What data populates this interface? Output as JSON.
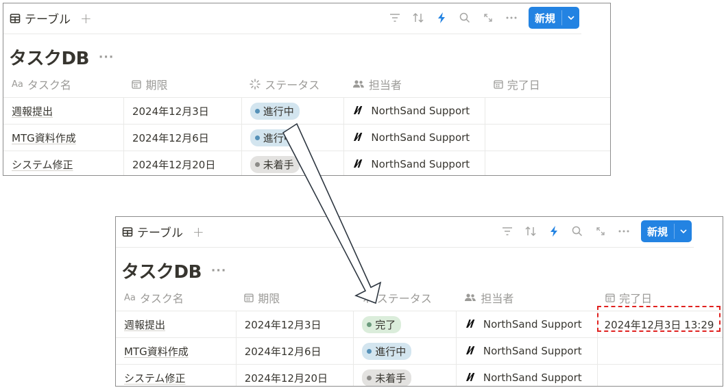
{
  "before": {
    "view_tab": "テーブル",
    "new_button": "新規",
    "db_title": "タスクDB",
    "columns": [
      "タスク名",
      "期限",
      "ステータス",
      "担当者",
      "完了日"
    ],
    "rows": [
      {
        "name": "週報提出",
        "deadline": "2024年12月3日",
        "status": "進行中",
        "status_color": "blue",
        "assignee": "NorthSand Support",
        "done_date": ""
      },
      {
        "name": "MTG資料作成",
        "deadline": "2024年12月6日",
        "status": "進行中",
        "status_color": "blue",
        "assignee": "NorthSand Support",
        "done_date": ""
      },
      {
        "name": "システム修正",
        "deadline": "2024年12月20日",
        "status": "未着手",
        "status_color": "gray",
        "assignee": "NorthSand Support",
        "done_date": ""
      }
    ]
  },
  "after": {
    "view_tab": "テーブル",
    "new_button": "新規",
    "db_title": "タスクDB",
    "columns": [
      "タスク名",
      "期限",
      "ステータス",
      "担当者",
      "完了日"
    ],
    "rows": [
      {
        "name": "週報提出",
        "deadline": "2024年12月3日",
        "status": "完了",
        "status_color": "green",
        "assignee": "NorthSand Support",
        "done_date": "2024年12月3日 13:29"
      },
      {
        "name": "MTG資料作成",
        "deadline": "2024年12月6日",
        "status": "進行中",
        "status_color": "blue",
        "assignee": "NorthSand Support",
        "done_date": ""
      },
      {
        "name": "システム修正",
        "deadline": "2024年12月20日",
        "status": "未着手",
        "status_color": "gray",
        "assignee": "NorthSand Support",
        "done_date": ""
      }
    ]
  },
  "column_icons": [
    "text-property-icon",
    "date-property-icon",
    "status-property-icon",
    "person-property-icon",
    "date-property-icon"
  ],
  "colors": {
    "accent": "#2383e2",
    "highlight": "#e0201e"
  }
}
